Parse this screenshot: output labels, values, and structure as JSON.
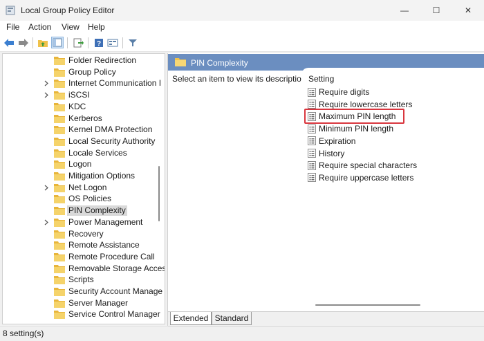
{
  "window": {
    "title": "Local Group Policy Editor",
    "controls": {
      "minimize": "—",
      "maximize": "☐",
      "close": "✕"
    }
  },
  "menu": [
    "File",
    "Action",
    "View",
    "Help"
  ],
  "toolbar": {
    "icons": [
      "back-arrow-icon",
      "forward-arrow-icon",
      "up-folder-icon",
      "show-tree-icon",
      "export-list-icon",
      "help-icon",
      "properties-icon",
      "filter-icon"
    ]
  },
  "tree": {
    "items": [
      {
        "label": "Folder Redirection",
        "expandable": false
      },
      {
        "label": "Group Policy",
        "expandable": false
      },
      {
        "label": "Internet Communication I",
        "expandable": true
      },
      {
        "label": "iSCSI",
        "expandable": true
      },
      {
        "label": "KDC",
        "expandable": false
      },
      {
        "label": "Kerberos",
        "expandable": false
      },
      {
        "label": "Kernel DMA Protection",
        "expandable": false
      },
      {
        "label": "Local Security Authority",
        "expandable": false
      },
      {
        "label": "Locale Services",
        "expandable": false
      },
      {
        "label": "Logon",
        "expandable": false
      },
      {
        "label": "Mitigation Options",
        "expandable": false
      },
      {
        "label": "Net Logon",
        "expandable": true
      },
      {
        "label": "OS Policies",
        "expandable": false
      },
      {
        "label": "PIN Complexity",
        "expandable": false,
        "selected": true
      },
      {
        "label": "Power Management",
        "expandable": true
      },
      {
        "label": "Recovery",
        "expandable": false
      },
      {
        "label": "Remote Assistance",
        "expandable": false
      },
      {
        "label": "Remote Procedure Call",
        "expandable": false
      },
      {
        "label": "Removable Storage Acces",
        "expandable": false
      },
      {
        "label": "Scripts",
        "expandable": false
      },
      {
        "label": "Security Account Manage",
        "expandable": false
      },
      {
        "label": "Server Manager",
        "expandable": false
      },
      {
        "label": "Service Control Manager",
        "expandable": false
      }
    ]
  },
  "details": {
    "header": "PIN Complexity",
    "description": "Select an item to view its description.",
    "column_header": "Setting",
    "settings": [
      "Require digits",
      "Require lowercase letters",
      "Maximum PIN length",
      "Minimum PIN length",
      "Expiration",
      "History",
      "Require special characters",
      "Require uppercase letters"
    ],
    "highlighted": "Maximum PIN length"
  },
  "tabs": [
    "Extended",
    "Standard"
  ],
  "status": "8 setting(s)",
  "colors": {
    "header": "#6b8ec0",
    "highlight": "#d9363e",
    "folder": "#f0c24b"
  }
}
